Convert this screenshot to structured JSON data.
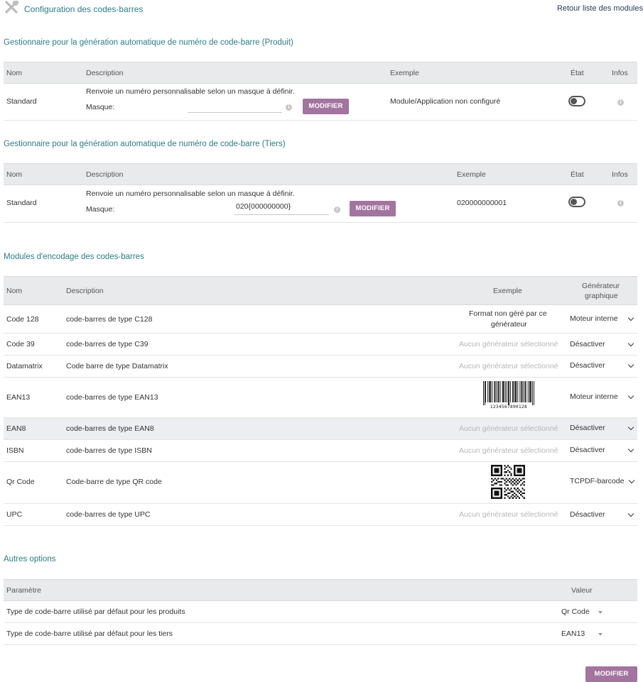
{
  "header": {
    "title": "Configuration des codes-barres",
    "back_link": "Retour liste des modules"
  },
  "product_section": {
    "title": "Gestionnaire pour la génération automatique de numéro de code-barre (Produit)",
    "columns": {
      "nom": "Nom",
      "description": "Description",
      "exemple": "Exemple",
      "etat": "État",
      "infos": "Infos"
    },
    "row": {
      "nom": "Standard",
      "description": "Renvoie un numéro personnalisable selon un masque à définir.",
      "mask_label": "Masque:",
      "mask_value": "",
      "button": "MODIFIER",
      "exemple": "Module/Application non configuré"
    }
  },
  "tiers_section": {
    "title": "Gestionnaire pour la génération automatique de numéro de code-barre (Tiers)",
    "columns": {
      "nom": "Nom",
      "description": "Description",
      "exemple": "Exemple",
      "etat": "État",
      "infos": "Infos"
    },
    "row": {
      "nom": "Standard",
      "description": "Renvoie un numéro personnalisable selon un masque à définir.",
      "mask_label": "Masque:",
      "mask_value": "020{000000000}",
      "button": "MODIFIER",
      "exemple": "020000000001"
    }
  },
  "encoding_section": {
    "title": "Modules d'encodage des codes-barres",
    "columns": {
      "nom": "Nom",
      "description": "Description",
      "exemple": "Exemple",
      "generateur_line1": "Générateur",
      "generateur_line2": "graphique"
    },
    "rows": [
      {
        "nom": "Code 128",
        "description": "code-barres de type C128",
        "exemple_line1": "Format non géré par ce",
        "exemple_line2": "générateur",
        "generateur": "Moteur interne"
      },
      {
        "nom": "Code 39",
        "description": "code-barres de type C39",
        "exemple": "Aucun générateur sélectionné",
        "generateur": "Désactiver"
      },
      {
        "nom": "Datamatrix",
        "description": "Code barre de type Datamatrix",
        "exemple": "Aucun générateur sélectionné",
        "generateur": "Désactiver"
      },
      {
        "nom": "EAN13",
        "description": "code-barres de type EAN13",
        "exemple_barcode_digits": "1234567890128",
        "generateur": "Moteur interne"
      },
      {
        "nom": "EAN8",
        "description": "code-barres de type EAN8",
        "exemple": "Aucun générateur sélectionné",
        "generateur": "Désactiver"
      },
      {
        "nom": "ISBN",
        "description": "code-barres de type ISBN",
        "exemple": "Aucun générateur sélectionné",
        "generateur": "Désactiver"
      },
      {
        "nom": "Qr Code",
        "description": "Code-barre de type QR code",
        "exemple_image": "qr-code",
        "generateur": "TCPDF-barcode"
      },
      {
        "nom": "UPC",
        "description": "code-barres de type UPC",
        "exemple": "Aucun générateur sélectionné",
        "generateur": "Désactiver"
      }
    ]
  },
  "other_section": {
    "title": "Autres options",
    "columns": {
      "parametre": "Paramètre",
      "valeur": "Valeur"
    },
    "rows": [
      {
        "label": "Type de code-barre utilisé par défaut pour les produits",
        "value": "Qr Code"
      },
      {
        "label": "Type de code-barre utilisé par défaut pour les tiers",
        "value": "EAN13"
      }
    ]
  },
  "footer": {
    "button": "MODIFIER"
  },
  "colors": {
    "accent": "#2c7d87",
    "button": "#a3749f",
    "header_bg": "#e8eaec"
  }
}
